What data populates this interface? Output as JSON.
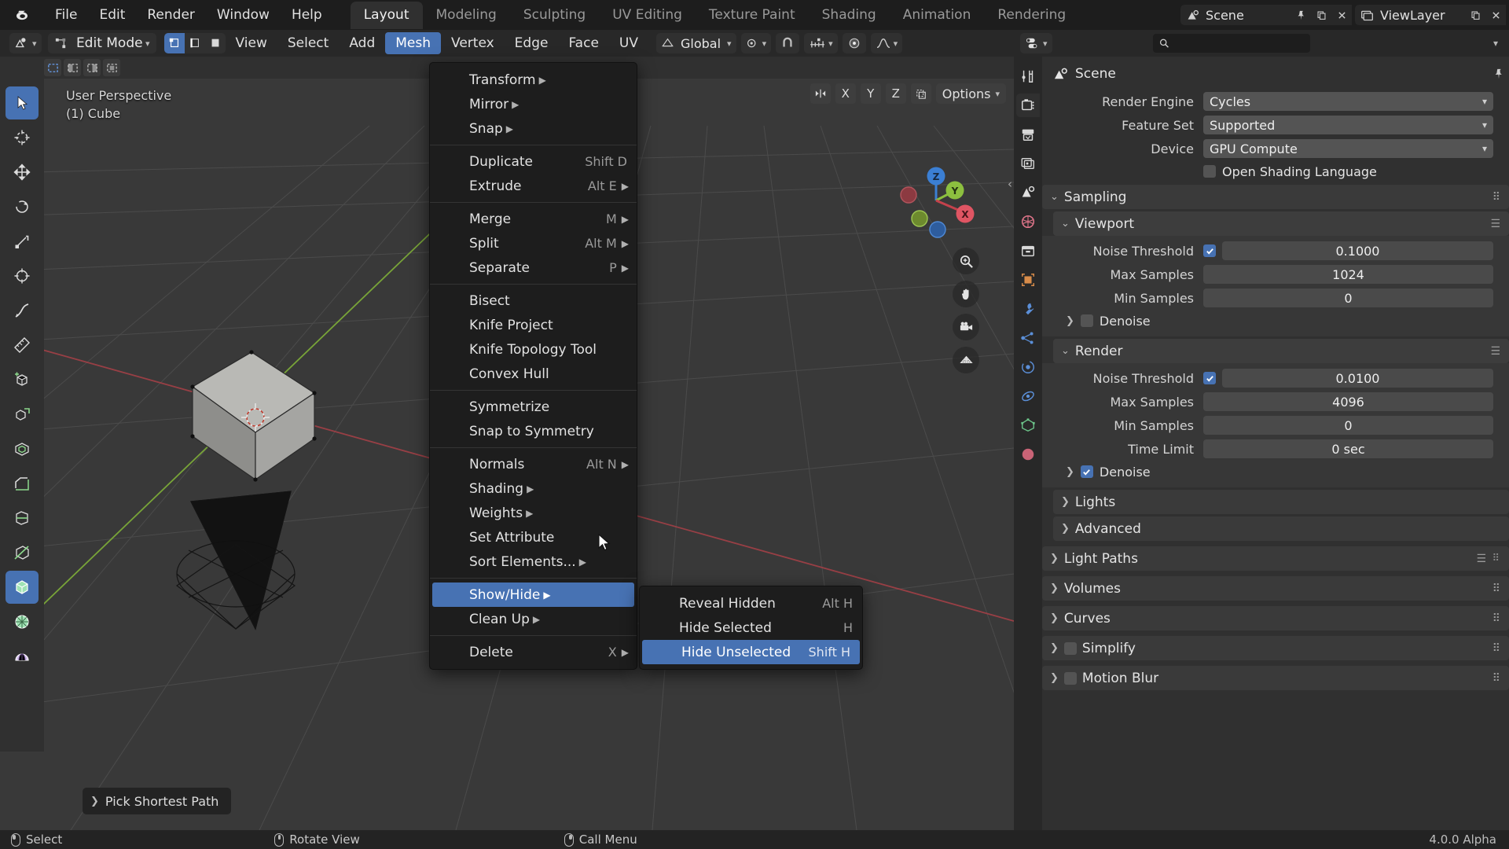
{
  "app": {
    "logo_icon": "blender-logo-icon",
    "version": "4.0.0 Alpha"
  },
  "topbar": {
    "menus": [
      "File",
      "Edit",
      "Render",
      "Window",
      "Help"
    ],
    "workspaces": [
      {
        "label": "Layout",
        "active": true
      },
      {
        "label": "Modeling",
        "active": false
      },
      {
        "label": "Sculpting",
        "active": false
      },
      {
        "label": "UV Editing",
        "active": false
      },
      {
        "label": "Texture Paint",
        "active": false
      },
      {
        "label": "Shading",
        "active": false
      },
      {
        "label": "Animation",
        "active": false
      },
      {
        "label": "Rendering",
        "active": false
      }
    ],
    "scene_name": "Scene",
    "viewlayer_name": "ViewLayer",
    "scene_icon": "scene-icon",
    "viewlayer_icon": "viewlayer-icon",
    "pin_icon": "pin-icon",
    "new_scene_icon": "new-scene-icon",
    "remove_scene_icon": "x-icon",
    "new_viewlayer_icon": "copy-icon",
    "remove_viewlayer_icon": "x-icon"
  },
  "viewport_header": {
    "editor_type_icon": "editor-type-icon",
    "mode": "Edit Mode",
    "select_modes": [
      {
        "name": "vertex-select-icon",
        "active": true
      },
      {
        "name": "edge-select-icon",
        "active": false
      },
      {
        "name": "face-select-icon",
        "active": false
      }
    ],
    "menus": [
      {
        "label": "View",
        "open": false
      },
      {
        "label": "Select",
        "open": false
      },
      {
        "label": "Add",
        "open": false
      },
      {
        "label": "Mesh",
        "open": true
      },
      {
        "label": "Vertex",
        "open": false
      },
      {
        "label": "Edge",
        "open": false
      },
      {
        "label": "Face",
        "open": false
      },
      {
        "label": "UV",
        "open": false
      }
    ],
    "transform_orientation": "Global",
    "snap_icon": "magnet-icon",
    "proportional_icon": "proportional-edit-icon",
    "falloff_icon": "falloff-curve-icon",
    "pivot_icon": "pivot-point-icon",
    "snapping_icon": "snap-increment-icon"
  },
  "viewport": {
    "view_name": "User Perspective",
    "collection_object": "(1) Cube",
    "options_label": "Options",
    "axis_buttons": [
      "X",
      "Y",
      "Z"
    ],
    "mirror_icon": "mirror-x-icon",
    "xray_icon": "xray-toggle-icon",
    "gizmo_axes": [
      "X",
      "Y",
      "Z"
    ],
    "nav_buttons": [
      "zoom-icon",
      "pan-hand-icon",
      "camera-view-icon",
      "toggle-ortho-icon"
    ],
    "operator_panel_label": "Pick Shortest Path",
    "operator_panel_chevron": "chevron-right-icon",
    "sidebar_arrow_icon": "chevron-left-icon"
  },
  "toolbar": {
    "tools": [
      {
        "name": "tweak-tool",
        "active": true
      },
      {
        "name": "cursor-tool",
        "active": false
      },
      {
        "name": "move-tool",
        "active": false
      },
      {
        "name": "rotate-tool",
        "active": false
      },
      {
        "name": "scale-tool",
        "active": false
      },
      {
        "name": "transform-tool",
        "active": false
      },
      {
        "name": "annotate-tool",
        "active": false
      },
      {
        "name": "measure-tool",
        "active": false
      },
      {
        "name": "add-cube-tool",
        "active": false
      },
      {
        "name": "extrude-region-tool",
        "active": false
      },
      {
        "name": "inset-faces-tool",
        "active": false
      },
      {
        "name": "bevel-tool",
        "active": false
      },
      {
        "name": "loop-cut-tool",
        "active": false
      },
      {
        "name": "knife-tool",
        "active": false
      },
      {
        "name": "poly-build-tool",
        "active": true
      },
      {
        "name": "spin-tool",
        "active": false
      },
      {
        "name": "smooth-tool",
        "active": false
      }
    ]
  },
  "tool_header": {
    "buttons": [
      "select-box-icon",
      "select-circle-icon",
      "select-lasso-icon",
      "select-extend-icon"
    ]
  },
  "mesh_menu": {
    "items": [
      {
        "label": "Transform",
        "accel": "T",
        "shortcut": "",
        "arrow": true,
        "selected": false,
        "sep_after": false
      },
      {
        "label": "Mirror",
        "accel": "M",
        "shortcut": "",
        "arrow": true,
        "selected": false,
        "sep_after": false
      },
      {
        "label": "Snap",
        "accel": "S",
        "shortcut": "",
        "arrow": true,
        "selected": false,
        "sep_after": true
      },
      {
        "label": "Duplicate",
        "accel": "D",
        "shortcut": "Shift D",
        "arrow": false,
        "selected": false,
        "sep_after": false
      },
      {
        "label": "Extrude",
        "accel": "E",
        "shortcut": "Alt E",
        "arrow": true,
        "selected": false,
        "sep_after": true
      },
      {
        "label": "Merge",
        "accel": "r",
        "shortcut": "M",
        "arrow": true,
        "selected": false,
        "sep_after": false
      },
      {
        "label": "Split",
        "accel": "l",
        "shortcut": "Alt M",
        "arrow": true,
        "selected": false,
        "sep_after": false
      },
      {
        "label": "Separate",
        "accel": "a",
        "shortcut": "P",
        "arrow": true,
        "selected": false,
        "sep_after": true
      },
      {
        "label": "Bisect",
        "accel": "B",
        "shortcut": "",
        "arrow": false,
        "selected": false,
        "sep_after": false
      },
      {
        "label": "Knife Project",
        "accel": "K",
        "shortcut": "",
        "arrow": false,
        "selected": false,
        "sep_after": false
      },
      {
        "label": "Knife Topology Tool",
        "accel": "i",
        "shortcut": "",
        "arrow": false,
        "selected": false,
        "sep_after": false
      },
      {
        "label": "Convex Hull",
        "accel": "C",
        "shortcut": "",
        "arrow": false,
        "selected": false,
        "sep_after": true
      },
      {
        "label": "Symmetrize",
        "accel": "y",
        "shortcut": "",
        "arrow": false,
        "selected": false,
        "sep_after": false
      },
      {
        "label": "Snap to Symmetry",
        "accel": "o",
        "shortcut": "",
        "arrow": false,
        "selected": false,
        "sep_after": true
      },
      {
        "label": "Normals",
        "accel": "N",
        "shortcut": "Alt N",
        "arrow": true,
        "selected": false,
        "sep_after": false
      },
      {
        "label": "Shading",
        "accel": "g",
        "shortcut": "",
        "arrow": true,
        "selected": false,
        "sep_after": false
      },
      {
        "label": "Weights",
        "accel": "W",
        "shortcut": "",
        "arrow": true,
        "selected": false,
        "sep_after": false
      },
      {
        "label": "Set Attribute",
        "accel": "A",
        "shortcut": "",
        "arrow": false,
        "selected": false,
        "sep_after": false
      },
      {
        "label": "Sort Elements...",
        "accel": "",
        "shortcut": "",
        "arrow": true,
        "selected": false,
        "sep_after": true
      },
      {
        "label": "Show/Hide",
        "accel": "H",
        "shortcut": "",
        "arrow": true,
        "selected": true,
        "sep_after": false
      },
      {
        "label": "Clean Up",
        "accel": "U",
        "shortcut": "",
        "arrow": true,
        "selected": false,
        "sep_after": true
      },
      {
        "label": "Delete",
        "accel": "D",
        "shortcut": "X",
        "arrow": true,
        "selected": false,
        "sep_after": false
      }
    ]
  },
  "show_hide_submenu": {
    "items": [
      {
        "label": "Reveal Hidden",
        "shortcut": "Alt H",
        "selected": false
      },
      {
        "label": "Hide Selected",
        "shortcut": "H",
        "selected": false
      },
      {
        "label": "Hide Unselected",
        "shortcut": "Shift H",
        "selected": true
      }
    ]
  },
  "properties": {
    "editor_icon": "properties-editor-icon",
    "search_placeholder": "",
    "search_icon": "search-icon",
    "pin_icon": "pin-icon",
    "breadcrumb": "Scene",
    "breadcrumb_icon": "scene-data-icon",
    "tabs": [
      {
        "name": "tool-tab",
        "icon": "tool-icon",
        "active": false
      },
      {
        "name": "render-tab",
        "icon": "camera-back-icon",
        "active": true
      },
      {
        "name": "output-tab",
        "icon": "printer-icon",
        "active": false
      },
      {
        "name": "viewlayer-tab",
        "icon": "images-icon",
        "active": false
      },
      {
        "name": "scene-tab",
        "icon": "cone-sphere-icon",
        "active": false
      },
      {
        "name": "world-tab",
        "icon": "world-icon",
        "active": false
      },
      {
        "name": "collection-tab",
        "icon": "box-icon",
        "active": false
      },
      {
        "name": "object-tab",
        "icon": "orange-square-icon",
        "active": false
      },
      {
        "name": "modifier-tab",
        "icon": "wrench-icon",
        "active": false
      },
      {
        "name": "particles-tab",
        "icon": "particles-icon",
        "active": false
      },
      {
        "name": "physics-tab",
        "icon": "physics-orbit-icon",
        "active": false
      },
      {
        "name": "constraints-tab",
        "icon": "constraint-icon",
        "active": false
      },
      {
        "name": "data-tab",
        "icon": "mesh-data-icon",
        "active": false
      },
      {
        "name": "material-tab",
        "icon": "material-sphere-icon",
        "active": false
      }
    ],
    "render_engine": {
      "label": "Render Engine",
      "value": "Cycles"
    },
    "feature_set": {
      "label": "Feature Set",
      "value": "Supported"
    },
    "device": {
      "label": "Device",
      "value": "GPU Compute"
    },
    "osl": {
      "label": "Open Shading Language",
      "checked": false
    },
    "sampling": {
      "title": "Sampling",
      "viewport": {
        "title": "Viewport",
        "noise_threshold": {
          "label": "Noise Threshold",
          "value": "0.1000",
          "checked": true
        },
        "max_samples": {
          "label": "Max Samples",
          "value": "1024"
        },
        "min_samples": {
          "label": "Min Samples",
          "value": "0"
        },
        "denoise": {
          "label": "Denoise",
          "checked": false
        }
      },
      "render": {
        "title": "Render",
        "noise_threshold": {
          "label": "Noise Threshold",
          "value": "0.0100",
          "checked": true
        },
        "max_samples": {
          "label": "Max Samples",
          "value": "4096"
        },
        "min_samples": {
          "label": "Min Samples",
          "value": "0"
        },
        "time_limit": {
          "label": "Time Limit",
          "value": "0 sec"
        },
        "denoise": {
          "label": "Denoise",
          "checked": true
        }
      },
      "lights": {
        "title": "Lights"
      },
      "advanced": {
        "title": "Advanced"
      }
    },
    "collapsed_panels": [
      {
        "title": "Light Paths",
        "has_dots": true,
        "has_list": true,
        "checkbox": null
      },
      {
        "title": "Volumes",
        "has_dots": true,
        "has_list": false,
        "checkbox": null
      },
      {
        "title": "Curves",
        "has_dots": true,
        "has_list": false,
        "checkbox": null
      },
      {
        "title": "Simplify",
        "has_dots": true,
        "has_list": false,
        "checkbox": false
      },
      {
        "title": "Motion Blur",
        "has_dots": true,
        "has_list": false,
        "checkbox": false
      }
    ]
  },
  "statusbar": {
    "items": [
      {
        "mouse": "left",
        "label": "Select"
      },
      {
        "mouse": "middle",
        "label": "Rotate View"
      },
      {
        "mouse": "right",
        "label": "Call Menu"
      }
    ],
    "version": "4.0.0 Alpha"
  },
  "colors": {
    "accent_blue": "#4772b3",
    "bg_dark": "#1d1d1d",
    "bg_editor": "#303030",
    "viewport_bg": "#393939",
    "axis_x": "#c44c52",
    "axis_y": "#8cbf3f",
    "axis_z": "#3b7fd4"
  }
}
